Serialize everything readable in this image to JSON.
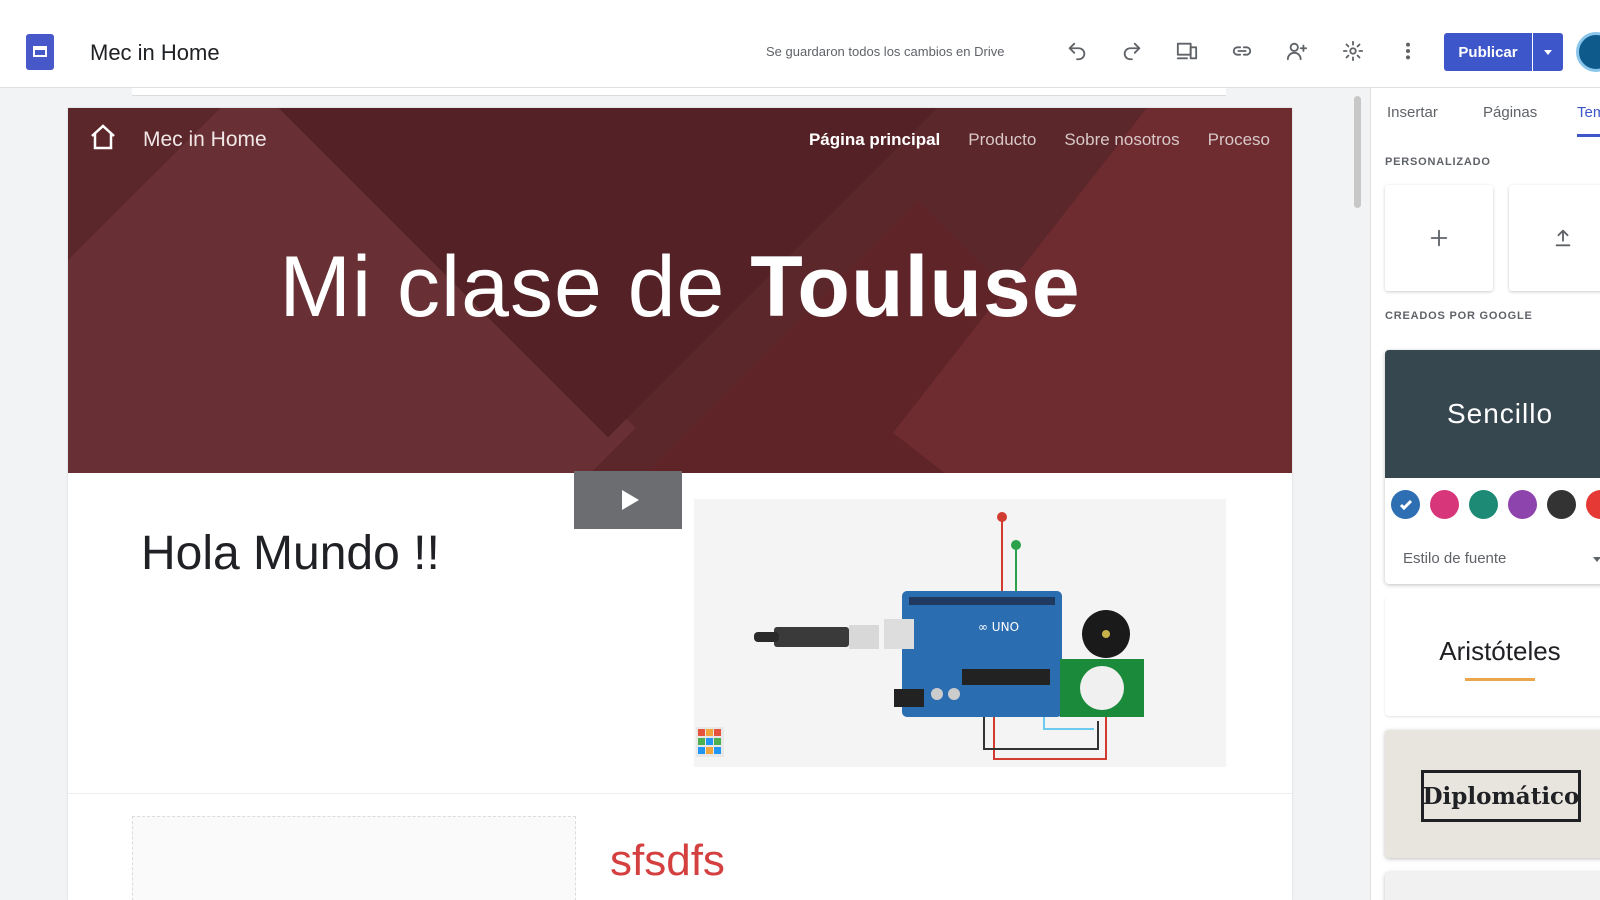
{
  "app": {
    "title": "Mec in Home",
    "save_status": "Se guardaron todos los cambios en Drive",
    "publish_label": "Publicar",
    "toolbar_icons": [
      "undo-icon",
      "redo-icon",
      "preview-devices-icon",
      "link-icon",
      "share-user-icon",
      "gear-icon",
      "more-vert-icon"
    ]
  },
  "site": {
    "name": "Mec in Home",
    "nav": [
      "Página principal",
      "Producto",
      "Sobre nosotros",
      "Proceso"
    ],
    "hero_title_light": "Mi clase de ",
    "hero_title_bold": "Touluse",
    "section_title": "Hola Mundo !!",
    "section_subtitle": "sfsdfs"
  },
  "panel": {
    "tabs": [
      "Insertar",
      "Páginas",
      "Tem"
    ],
    "active_tab": "Tem",
    "custom_label": "PERSONALIZADO",
    "google_label": "CREADOS POR GOOGLE",
    "themes": {
      "simple": "Sencillo",
      "aristo": "Aristóteles",
      "diplo": "Diplomático"
    },
    "font_style_label": "Estilo de fuente",
    "swatch_colors": [
      "#2e6fb3",
      "#d8367a",
      "#1c8a74",
      "#8e44ad",
      "#333333",
      "#e53935"
    ]
  },
  "colors": {
    "accent": "#3d56c9",
    "hero_bg": "#5c272b"
  }
}
